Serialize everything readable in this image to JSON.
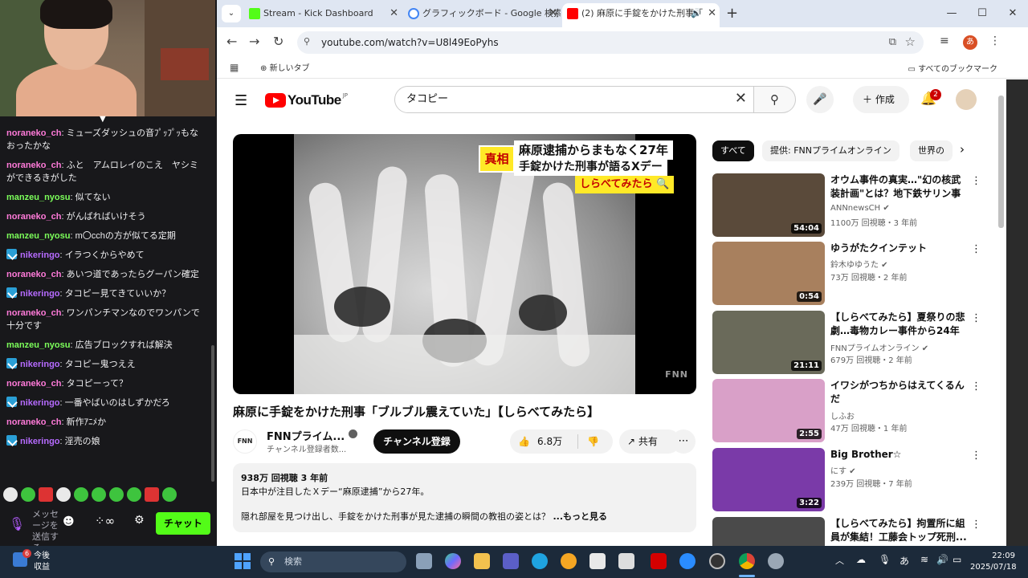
{
  "stream_chat": {
    "collapse_icon": "chevron-down-icon",
    "messages": [
      {
        "user": "noraneko_ch",
        "user_color": "#ff7ad9",
        "badge": false,
        "text": "ミューズダッシュの音ﾌﾟｯﾌﾟｯもなおったかな"
      },
      {
        "user": "noraneko_ch",
        "user_color": "#ff7ad9",
        "badge": false,
        "text": "ふと　アムロレイのこえ　ヤシミができるきがした"
      },
      {
        "user": "manzeu_nyosu",
        "user_color": "#7cff5a",
        "badge": false,
        "text": "似てない"
      },
      {
        "user": "noraneko_ch",
        "user_color": "#ff7ad9",
        "badge": false,
        "text": "がんばればいけそう"
      },
      {
        "user": "manzeu_nyosu",
        "user_color": "#7cff5a",
        "badge": false,
        "text": "m〇cchの方が似てる定期"
      },
      {
        "user": "nikeringo",
        "user_color": "#b66bff",
        "badge": true,
        "text": "イラつくからやめて"
      },
      {
        "user": "noraneko_ch",
        "user_color": "#ff7ad9",
        "badge": false,
        "text": "あいつ道であったらグーパン確定"
      },
      {
        "user": "nikeringo",
        "user_color": "#b66bff",
        "badge": true,
        "text": "タコピー見てきていいか？"
      },
      {
        "user": "noraneko_ch",
        "user_color": "#ff7ad9",
        "badge": false,
        "text": "ワンパンチマンなのでワンパンで十分です"
      },
      {
        "user": "manzeu_nyosu",
        "user_color": "#7cff5a",
        "badge": false,
        "text": "広告ブロックすれば解決"
      },
      {
        "user": "nikeringo",
        "user_color": "#b66bff",
        "badge": true,
        "text": "タコピー鬼つええ"
      },
      {
        "user": "noraneko_ch",
        "user_color": "#ff7ad9",
        "badge": false,
        "text": "タコピーって？"
      },
      {
        "user": "nikeringo",
        "user_color": "#b66bff",
        "badge": true,
        "text": "一番やばいのはしずかだろ"
      },
      {
        "user": "noraneko_ch",
        "user_color": "#ff7ad9",
        "badge": false,
        "text": "新作ｱﾆﾒか"
      },
      {
        "user": "nikeringo",
        "user_color": "#b66bff",
        "badge": true,
        "text": "淫売の娘"
      }
    ],
    "input_placeholder": "メッセージを送信する",
    "send_label": "チャット",
    "infinity_label": "∞"
  },
  "browser": {
    "tabs": [
      {
        "label": "Stream - Kick Dashboard",
        "favicon_color": "#53fc18",
        "active": false
      },
      {
        "label": "グラフィックボード - Google 検索",
        "favicon_color": "#4285f4",
        "active": false
      },
      {
        "label": "(2) 麻原に手錠をかけた刑事「",
        "favicon_color": "#ff0000",
        "active": true
      }
    ],
    "url": "youtube.com/watch?v=U8l49EoPyhs",
    "profile_initial": "あ",
    "bookmarks": {
      "new_tab": "新しいタブ",
      "all_bookmarks": "すべてのブックマーク"
    }
  },
  "youtube": {
    "logo_text": "YouTube",
    "logo_region": "JP",
    "search_query": "タコピー",
    "create_label": "作成",
    "notification_count": "2",
    "video": {
      "caption_tag": "真相",
      "caption_line1": "麻原逮捕からまもなく27年",
      "caption_line2": "手錠かけた刑事が語るXデー",
      "caption_line3": "しらべてみたら",
      "watermark": "FNN",
      "title": "麻原に手錠をかけた刑事「ブルブル震えていた」【しらべてみたら】",
      "channel_name": "FNNプライム...",
      "channel_logo_text": "FNN",
      "channel_subs": "チャンネル登録者数...",
      "subscribe_label": "チャンネル登録",
      "like_count": "6.8万",
      "share_label": "共有",
      "views_meta": "938万 回視聴  3 年前",
      "desc_line1": "日本中が注目したＸデー“麻原逮捕”から27年。",
      "desc_line2": "隠れ部屋を見つけ出し、手錠をかけた刑事が見た逮捕の瞬間の教祖の姿とは？",
      "desc_more": "...もっと見る"
    },
    "chips": [
      {
        "label": "すべて",
        "active": true
      },
      {
        "label": "提供: FNNプライムオンライン",
        "active": false
      },
      {
        "label": "世界の",
        "active": false
      }
    ],
    "recommendations": [
      {
        "title": "オウム事件の真実…\"幻の核武装計画\"とは？地下鉄サリン事件...",
        "channel": "ANNnewsCH",
        "verified": true,
        "meta": "1100万 回視聴・3 年前",
        "duration": "54:04",
        "thumb": "#5a4a3a"
      },
      {
        "title": "ゆうがたクインテット",
        "channel": "鈴木ゆゆうた",
        "verified": true,
        "meta": "73万 回視聴・2 年前",
        "duration": "0:54",
        "thumb": "#a8805e"
      },
      {
        "title": "【しらべてみたら】夏祭りの悲劇…毒物カレー事件から24年",
        "channel": "FNNプライムオンライン",
        "verified": true,
        "meta": "679万 回視聴・2 年前",
        "duration": "21:11",
        "thumb": "#6a6a5a"
      },
      {
        "title": "イワシがつちからはえてくるんだ",
        "channel": "しふお",
        "verified": false,
        "meta": "47万 回視聴・1 年前",
        "duration": "2:55",
        "thumb": "#d9a0c8"
      },
      {
        "title": "Big Brother☆",
        "channel": "にす",
        "verified": true,
        "meta": "239万 回視聴・7 年前",
        "duration": "3:22",
        "thumb": "#7a3aa8"
      },
      {
        "title": "【しらべてみたら】拘置所に組員が集結！工藤会トップ死刑...",
        "channel": "",
        "verified": false,
        "meta": "",
        "duration": "",
        "thumb": "#4a4a4a"
      }
    ]
  },
  "taskbar": {
    "weather_badge": "6",
    "weather_line1": "今後",
    "weather_line2": "収益",
    "search_placeholder": "検索",
    "ime": "あ",
    "time": "22:09",
    "date": "2025/07/18"
  }
}
